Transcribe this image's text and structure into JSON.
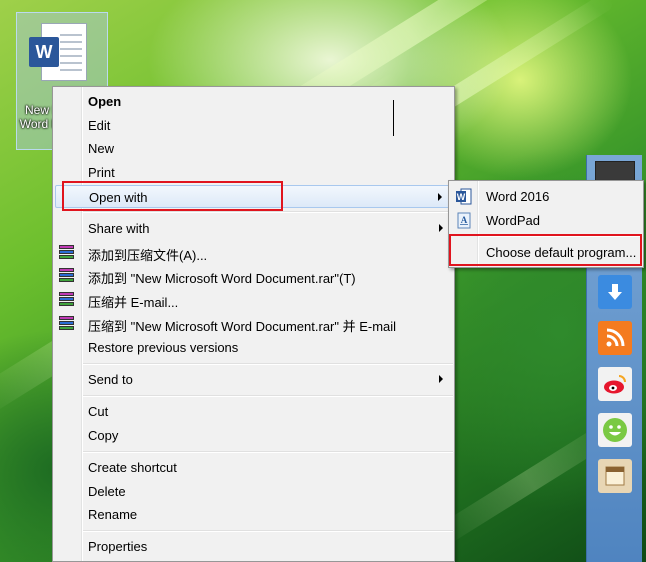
{
  "desktop": {
    "file_label": "New Microsoft Word Document"
  },
  "context_menu": {
    "items": [
      {
        "label": "Open"
      },
      {
        "label": "Edit"
      },
      {
        "label": "New"
      },
      {
        "label": "Print"
      },
      {
        "label": "Open with"
      },
      {
        "label": "Share with"
      },
      {
        "label": "添加到压缩文件(A)..."
      },
      {
        "label": "添加到 \"New Microsoft Word Document.rar\"(T)"
      },
      {
        "label": "压缩并 E-mail..."
      },
      {
        "label": "压缩到 \"New Microsoft Word Document.rar\" 并 E-mail"
      },
      {
        "label": "Restore previous versions"
      },
      {
        "label": "Send to"
      },
      {
        "label": "Cut"
      },
      {
        "label": "Copy"
      },
      {
        "label": "Create shortcut"
      },
      {
        "label": "Delete"
      },
      {
        "label": "Rename"
      },
      {
        "label": "Properties"
      }
    ]
  },
  "open_with_submenu": {
    "items": [
      {
        "label": "Word 2016",
        "icon": "word-icon"
      },
      {
        "label": "WordPad",
        "icon": "wordpad-icon"
      },
      {
        "label": "Choose default program..."
      }
    ]
  },
  "colors": {
    "highlight_box": "#e0141e",
    "hover": "#dde9f8",
    "menu_bg": "#f1f1f1",
    "word_blue": "#2b579a"
  },
  "icons": {
    "word_badge": "W"
  }
}
